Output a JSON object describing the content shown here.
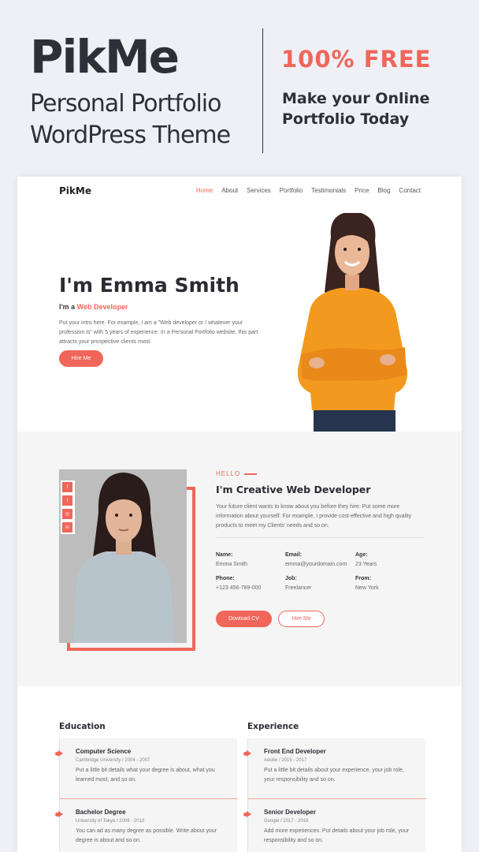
{
  "banner": {
    "logo": "PikMe",
    "tagline": "Personal Portfolio WordPress Theme",
    "free_label": "100% FREE",
    "cta_text": "Make your Online Portfolio Today"
  },
  "nav": {
    "logo": "PikMe",
    "items": [
      "Home",
      "About",
      "Services",
      "Portfolio",
      "Testimonials",
      "Price",
      "Blog",
      "Contact"
    ]
  },
  "hero": {
    "name": "I'm Emma Smith",
    "role_prefix": "I'm a",
    "role_highlight": "Web Developer",
    "intro": "Put your intro here. For example, I am a \"Web developer or / whatever your profession is\" with 5 years of experience. In a Personal Portfolio website, this part attracts your prospective clients most.",
    "hire_button": "Hire Me"
  },
  "about": {
    "social": [
      "f",
      "t",
      "◎",
      "in"
    ],
    "hello": "HELLO",
    "title": "I'm Creative Web Developer",
    "text": "Your future client wants to know about you before they hire. Put some more information about yourself. For example, I provide cost-effective and high quality products to meet my Clients' needs and so on.",
    "info": {
      "name_label": "Name:",
      "name_value": "Emma Smith",
      "email_label": "Email:",
      "email_value": "emma@yourdomain.com",
      "age_label": "Age:",
      "age_value": "23 Years",
      "phone_label": "Phone:",
      "phone_value": "+123 456-789-000",
      "job_label": "Job:",
      "job_value": "Freelancer",
      "from_label": "From:",
      "from_value": "New York"
    },
    "download_button": "Dowload CV",
    "hire_button": "Hire Me"
  },
  "resume": {
    "education_title": "Education",
    "experience_title": "Experience",
    "education": [
      {
        "title": "Computer Science",
        "sub": "Cambridge University / 2004 - 2007",
        "text": "Put a little bit details what your degree is about, what you learned most, and so on."
      },
      {
        "title": "Bachelor Degree",
        "sub": "University of Tokyo / 2008 - 2010",
        "text": "You can ad as many degree as possible. Write about your degree is about and so on."
      }
    ],
    "experience": [
      {
        "title": "Front End Developer",
        "sub": "Adobe / 2015 - 2017",
        "text": "Put a little bit details about your experience, your job role, your responsibility and so on."
      },
      {
        "title": "Senior Developer",
        "sub": "Google / 2017 - 2018",
        "text": "Add more experiences. Put details about your job role, your responsibility and so on."
      }
    ]
  },
  "colors": {
    "accent": "#f0665a",
    "dark": "#2f2f38",
    "section_bg": "#f5f5f5"
  }
}
